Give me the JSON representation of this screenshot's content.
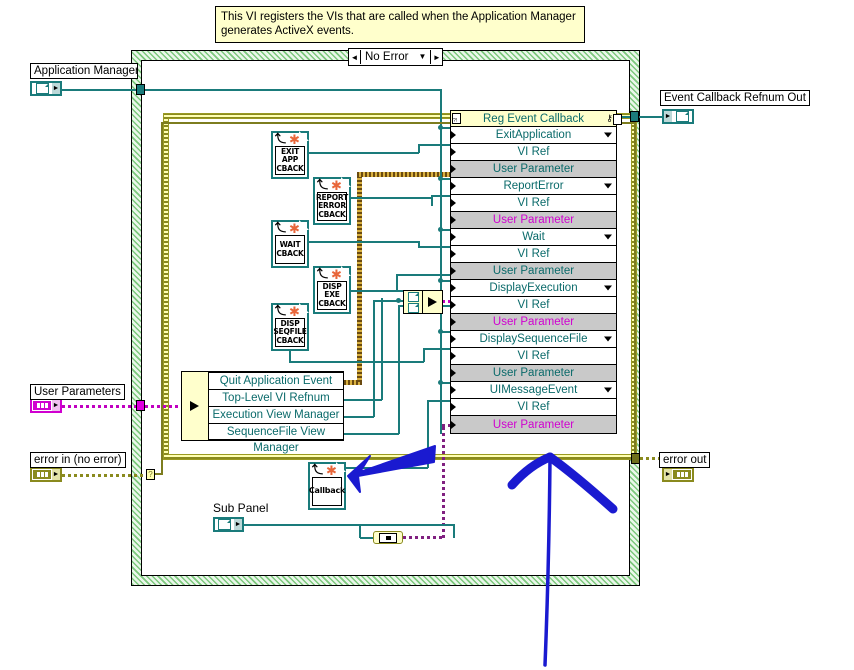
{
  "comment": {
    "text": "This VI registers the VIs that are called when the Application Manager generates ActiveX events."
  },
  "case_structure": {
    "selector_label": "No Error",
    "left_arrow": "◄",
    "right_arrow": "►",
    "dropdown": "▼"
  },
  "terminals": {
    "application_manager": {
      "label": "Application Manager",
      "type": "refnum-control"
    },
    "user_parameters": {
      "label": "User Parameters",
      "type": "cluster-control"
    },
    "error_in": {
      "label": "error in (no error)",
      "type": "error-cluster-control"
    },
    "sub_panel": {
      "label": "Sub Panel",
      "type": "refnum-control"
    },
    "event_callback_refnum_out": {
      "label": "Event Callback Refnum Out",
      "type": "refnum-indicator"
    },
    "error_out": {
      "label": "error out",
      "type": "error-cluster-indicator"
    }
  },
  "callback_vis": [
    {
      "name": "exit-app-cback",
      "lines": [
        "EXIT",
        "APP",
        "CBACK"
      ]
    },
    {
      "name": "report-error-cback",
      "lines": [
        "REPORT",
        "ERROR",
        "CBACK"
      ]
    },
    {
      "name": "wait-cback",
      "lines": [
        "WAIT",
        "CBACK"
      ]
    },
    {
      "name": "disp-exe-cback",
      "lines": [
        "DISP",
        "EXE",
        "CBACK"
      ]
    },
    {
      "name": "disp-seqfile-cback",
      "lines": [
        "DISP",
        "SEQFILE",
        "CBACK"
      ]
    },
    {
      "name": "callback-vi",
      "lines": [
        "Callback"
      ]
    }
  ],
  "reg_event_callback": {
    "title": "Reg Event Callback",
    "rows": [
      {
        "label": "ExitApplication",
        "kind": "event",
        "dropdown": true
      },
      {
        "label": "VI Ref",
        "kind": "viref",
        "dropdown": false
      },
      {
        "label": "User Parameter",
        "kind": "userparam-teal",
        "dropdown": false
      },
      {
        "label": "ReportError",
        "kind": "event",
        "dropdown": true
      },
      {
        "label": "VI Ref",
        "kind": "viref",
        "dropdown": false
      },
      {
        "label": "User Parameter",
        "kind": "userparam-magenta",
        "dropdown": false
      },
      {
        "label": "Wait",
        "kind": "event",
        "dropdown": true
      },
      {
        "label": "VI Ref",
        "kind": "viref",
        "dropdown": false
      },
      {
        "label": "User Parameter",
        "kind": "userparam-teal",
        "dropdown": false
      },
      {
        "label": "DisplayExecution",
        "kind": "event",
        "dropdown": true
      },
      {
        "label": "VI Ref",
        "kind": "viref",
        "dropdown": false
      },
      {
        "label": "User Parameter",
        "kind": "userparam-magenta",
        "dropdown": false
      },
      {
        "label": "DisplaySequenceFile",
        "kind": "event",
        "dropdown": true
      },
      {
        "label": "VI Ref",
        "kind": "viref",
        "dropdown": false
      },
      {
        "label": "User Parameter",
        "kind": "userparam-teal",
        "dropdown": false
      },
      {
        "label": "UIMessageEvent",
        "kind": "event",
        "dropdown": true
      },
      {
        "label": "VI Ref",
        "kind": "viref",
        "dropdown": false
      },
      {
        "label": "User Parameter",
        "kind": "userparam-magenta",
        "dropdown": false
      }
    ]
  },
  "user_parameters_cluster": {
    "items": [
      "Quit Application Event",
      "Top-Level VI Refnum",
      "Execution View Manager",
      "SequenceFile View Manager"
    ]
  },
  "colors": {
    "refnum_wire": "#1a7b7b",
    "cluster_wire": "#c000c0",
    "error_wire": "#8a8a1e",
    "event_text": "#0a6a6a",
    "userparam_magenta": "#d000d0",
    "comment_bg": "#ffffcc",
    "case_hatch": "#7dc87d",
    "annotation_arrow": "#1a1ad0",
    "node_header_bg": "#ffffcc",
    "userparam_row_bg": "#c9c9c9"
  },
  "annotations": [
    {
      "name": "arrow-to-callback-vi",
      "shape": "arrow-left-down",
      "color": "#1a1ad0"
    },
    {
      "name": "arrow-up-long",
      "shape": "arrow-up",
      "color": "#1a1ad0"
    }
  ]
}
